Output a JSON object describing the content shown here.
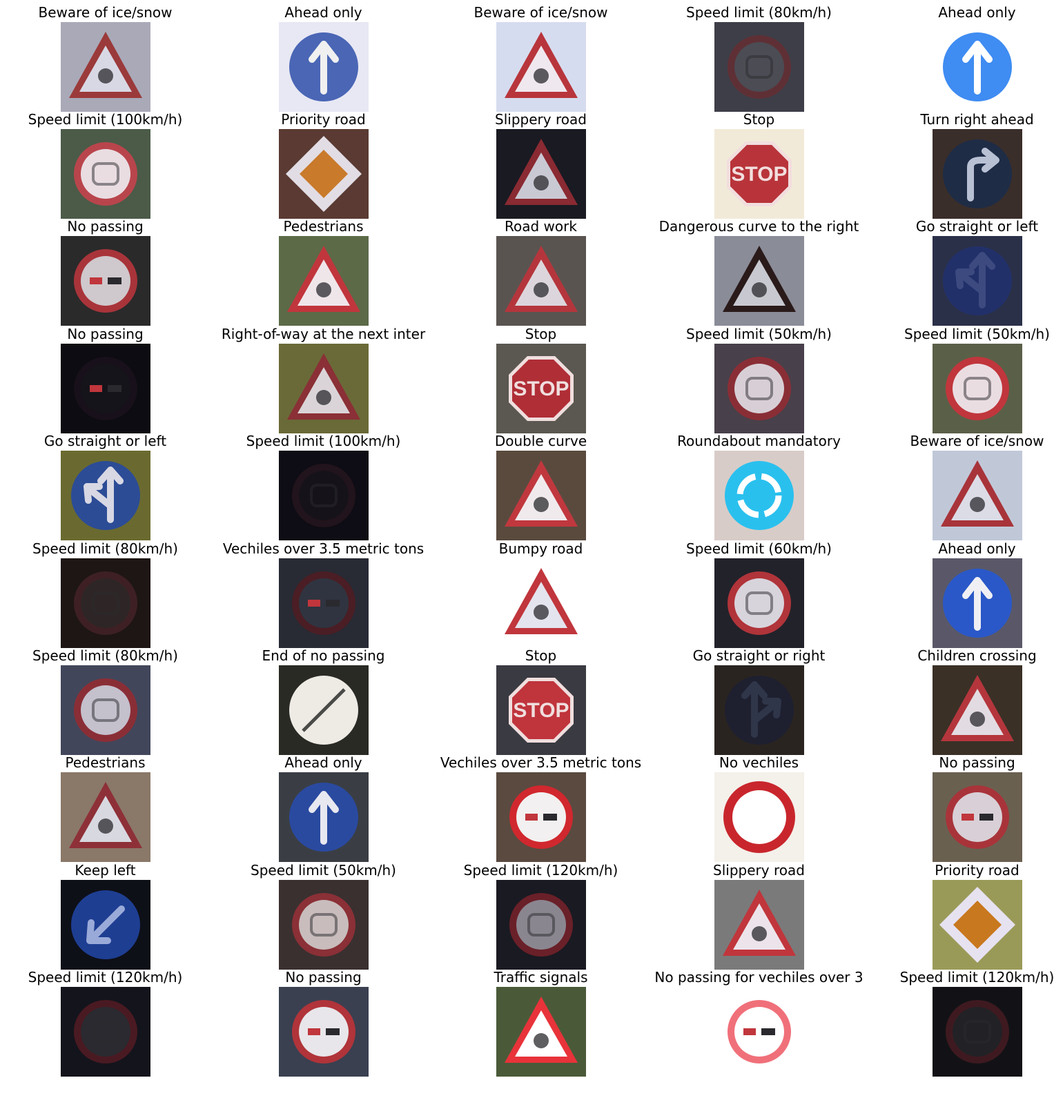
{
  "figure": {
    "columns": 5,
    "panels": [
      {
        "title": "Beware of ice/snow",
        "icon": "triangle-warning-sign",
        "bg": "#a9a9b8",
        "main": "#9b3a3a",
        "inner": "#d8d8e4"
      },
      {
        "title": "Ahead only",
        "icon": "blue-arrow-up-sign",
        "bg": "#e8e8f4",
        "main": "#4a66b5",
        "inner": "#f0f0f0"
      },
      {
        "title": "Beware of ice/snow",
        "icon": "triangle-warning-sign",
        "bg": "#d6dcef",
        "main": "#b8353c",
        "inner": "#efe8ee"
      },
      {
        "title": "Speed limit (80km/h)",
        "icon": "speed-limit-sign",
        "bg": "#3e3e48",
        "main": "#5e3035",
        "inner": "#4c4c55"
      },
      {
        "title": "Ahead only",
        "icon": "blue-arrow-up-sign",
        "bg": "#ffffff",
        "main": "#3f8cf2",
        "inner": "#ffffff"
      },
      {
        "title": "Speed limit (100km/h)",
        "icon": "speed-limit-sign",
        "bg": "#4b5b48",
        "main": "#b9454c",
        "inner": "#e9dde2"
      },
      {
        "title": "Priority road",
        "icon": "priority-diamond-sign",
        "bg": "#5a3a32",
        "main": "#c97a2a",
        "inner": "#e2dde5"
      },
      {
        "title": "Slippery road",
        "icon": "triangle-warning-sign",
        "bg": "#1a1a22",
        "main": "#8a2a32",
        "inner": "#c9c9d4"
      },
      {
        "title": "Stop",
        "icon": "stop-sign",
        "bg": "#f2ead8",
        "main": "#b8343a",
        "inner": "#f2dede"
      },
      {
        "title": "Turn right ahead",
        "icon": "blue-arrow-right-sign",
        "bg": "#3a2e2a",
        "main": "#1e2c46",
        "inner": "#b8c0d4"
      },
      {
        "title": "No passing",
        "icon": "no-passing-sign",
        "bg": "#2a2a2a",
        "main": "#a8343a",
        "inner": "#cfc8cc"
      },
      {
        "title": "Pedestrians",
        "icon": "triangle-warning-sign",
        "bg": "#5c6a48",
        "main": "#c0363c",
        "inner": "#efe6ea"
      },
      {
        "title": "Road work",
        "icon": "triangle-warning-sign",
        "bg": "#5a5450",
        "main": "#b4363c",
        "inner": "#dcd6dc"
      },
      {
        "title": "Dangerous curve to the right",
        "icon": "triangle-warning-sign",
        "bg": "#8a8c98",
        "main": "#2a1a1a",
        "inner": "#c8c8d0"
      },
      {
        "title": "Go straight or left",
        "icon": "blue-arrow-up-left-sign",
        "bg": "#2a3048",
        "main": "#22306a",
        "inner": "#3c4a80"
      },
      {
        "title": "No passing",
        "icon": "no-passing-sign",
        "bg": "#0c0c12",
        "main": "#18101a",
        "inner": "#14141a"
      },
      {
        "title": "Right-of-way at the next inter",
        "icon": "triangle-warning-sign",
        "bg": "#6a6a38",
        "main": "#8a3036",
        "inner": "#dad4d8"
      },
      {
        "title": "Stop",
        "icon": "stop-sign",
        "bg": "#5a5850",
        "main": "#b02e36",
        "inner": "#f0dede"
      },
      {
        "title": "Speed limit (50km/h)",
        "icon": "speed-limit-sign",
        "bg": "#48404a",
        "main": "#8a2e36",
        "inner": "#d8cfd6"
      },
      {
        "title": "Speed limit (50km/h)",
        "icon": "speed-limit-sign",
        "bg": "#5a6048",
        "main": "#c0363c",
        "inner": "#eadde2"
      },
      {
        "title": "Go straight or left",
        "icon": "blue-arrow-up-left-sign",
        "bg": "#6a6a30",
        "main": "#2c4c96",
        "inner": "#d8d8e4"
      },
      {
        "title": "Speed limit (100km/h)",
        "icon": "speed-limit-sign",
        "bg": "#0e0c14",
        "main": "#22141c",
        "inner": "#16121a"
      },
      {
        "title": "Double curve",
        "icon": "triangle-warning-sign",
        "bg": "#5a4a3e",
        "main": "#c0383e",
        "inner": "#f0eaec"
      },
      {
        "title": "Roundabout mandatory",
        "icon": "roundabout-sign",
        "bg": "#d8ccc8",
        "main": "#2ac0ee",
        "inner": "#ffffff"
      },
      {
        "title": "Beware of ice/snow",
        "icon": "triangle-warning-sign",
        "bg": "#c0c8d8",
        "main": "#a8343a",
        "inner": "#dcdce6"
      },
      {
        "title": "Speed limit (80km/h)",
        "icon": "speed-limit-sign",
        "bg": "#1e1614",
        "main": "#3e2024",
        "inner": "#2e2626"
      },
      {
        "title": "Vechiles over 3.5 metric tons",
        "icon": "no-passing-sign",
        "bg": "#282a34",
        "main": "#4a1e24",
        "inner": "#303440"
      },
      {
        "title": "Bumpy road",
        "icon": "triangle-warning-sign",
        "bg": "#ffffff",
        "main": "#c0363c",
        "inner": "#e4e4ee"
      },
      {
        "title": "Speed limit (60km/h)",
        "icon": "speed-limit-sign",
        "bg": "#22222a",
        "main": "#b0343a",
        "inner": "#d8d4dc"
      },
      {
        "title": "Ahead only",
        "icon": "blue-arrow-up-sign",
        "bg": "#5a5868",
        "main": "#2a58c8",
        "inner": "#f0f0f4"
      },
      {
        "title": "Speed limit (80km/h)",
        "icon": "speed-limit-sign",
        "bg": "#42465a",
        "main": "#8a2e36",
        "inner": "#c4c0cc"
      },
      {
        "title": "End of no passing",
        "icon": "end-of-restriction-sign",
        "bg": "#2a2a24",
        "main": "#eeeae4",
        "inner": "#4a4a48"
      },
      {
        "title": "Stop",
        "icon": "stop-sign",
        "bg": "#3a3a42",
        "main": "#c0343c",
        "inner": "#f0dede"
      },
      {
        "title": "Go straight or right",
        "icon": "blue-arrow-up-right-sign",
        "bg": "#2a2420",
        "main": "#1e2030",
        "inner": "#30364a"
      },
      {
        "title": "Children crossing",
        "icon": "triangle-warning-sign",
        "bg": "#3a3026",
        "main": "#b4363c",
        "inner": "#e2dce2"
      },
      {
        "title": "Pedestrians",
        "icon": "triangle-warning-sign",
        "bg": "#8a7868",
        "main": "#8e3038",
        "inner": "#d8d8e0"
      },
      {
        "title": "Ahead only",
        "icon": "blue-arrow-up-sign",
        "bg": "#3a3e44",
        "main": "#2a4aa0",
        "inner": "#e8e8f0"
      },
      {
        "title": "Vechiles over 3.5 metric tons",
        "icon": "no-passing-sign",
        "bg": "#5a4a40",
        "main": "#d0282e",
        "inner": "#f2f0f0"
      },
      {
        "title": "No vechiles",
        "icon": "no-vehicles-sign",
        "bg": "#f4f0ea",
        "main": "#c8262c",
        "inner": "#ffffff"
      },
      {
        "title": "No passing",
        "icon": "no-passing-sign",
        "bg": "#6a6050",
        "main": "#a8343a",
        "inner": "#d8d0d6"
      },
      {
        "title": "Keep left",
        "icon": "blue-arrow-down-left-sign",
        "bg": "#0e1018",
        "main": "#1e3e92",
        "inner": "#9aaad8"
      },
      {
        "title": "Speed limit (50km/h)",
        "icon": "speed-limit-sign",
        "bg": "#3a3030",
        "main": "#8a3036",
        "inner": "#c8bcbc"
      },
      {
        "title": "Speed limit (120km/h)",
        "icon": "speed-limit-sign",
        "bg": "#1a1a22",
        "main": "#6a2028",
        "inner": "#8a8690"
      },
      {
        "title": "Slippery road",
        "icon": "triangle-warning-sign",
        "bg": "#7a7a7a",
        "main": "#c0363c",
        "inner": "#ece4ea"
      },
      {
        "title": "Priority road",
        "icon": "priority-diamond-sign",
        "bg": "#9a9a58",
        "main": "#c8781e",
        "inner": "#e6e2f0"
      },
      {
        "title": "Speed limit (120km/h)",
        "icon": "speed-limit-sign",
        "bg": "#14141c",
        "main": "#4a1a22",
        "inner": "#2a2a30"
      },
      {
        "title": "No passing",
        "icon": "no-passing-sign",
        "bg": "#3a4050",
        "main": "#b0343a",
        "inner": "#e8e6ea"
      },
      {
        "title": "Traffic signals",
        "icon": "triangle-warning-sign",
        "bg": "#4a5a38",
        "main": "#e8333a",
        "inner": "#ffffff"
      },
      {
        "title": "No passing for vechiles over 3",
        "icon": "no-passing-sign",
        "bg": "#ffffff",
        "main": "#f0707a",
        "inner": "#ffffff"
      },
      {
        "title": "Speed limit (120km/h)",
        "icon": "speed-limit-sign",
        "bg": "#121216",
        "main": "#3e1a20",
        "inner": "#222226"
      }
    ]
  }
}
